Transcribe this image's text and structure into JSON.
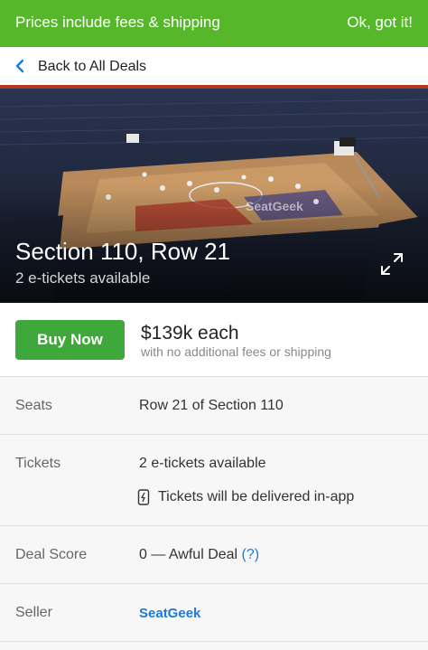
{
  "banner": {
    "message": "Prices include fees & shipping",
    "dismiss_label": "Ok, got it!",
    "color": "#57b72b"
  },
  "nav": {
    "back_label": "Back to All Deals"
  },
  "hero": {
    "title": "Section 110, Row 21",
    "subtitle": "2 e-tickets available",
    "watermark": "SeatGeek",
    "expand_icon": "expand-icon"
  },
  "purchase": {
    "buy_label": "Buy Now",
    "price": "$139k each",
    "price_note": "with no additional fees or shipping",
    "button_color": "#3fa83a"
  },
  "details": {
    "seats": {
      "label": "Seats",
      "value": "Row 21 of Section 110"
    },
    "tickets": {
      "label": "Tickets",
      "value": "2 e-tickets available",
      "delivery": "Tickets will be delivered in-app"
    },
    "deal_score": {
      "label": "Deal Score",
      "value": "0 — Awful Deal",
      "help": "(?)"
    },
    "seller": {
      "label": "Seller",
      "value": "SeatGeek"
    }
  }
}
